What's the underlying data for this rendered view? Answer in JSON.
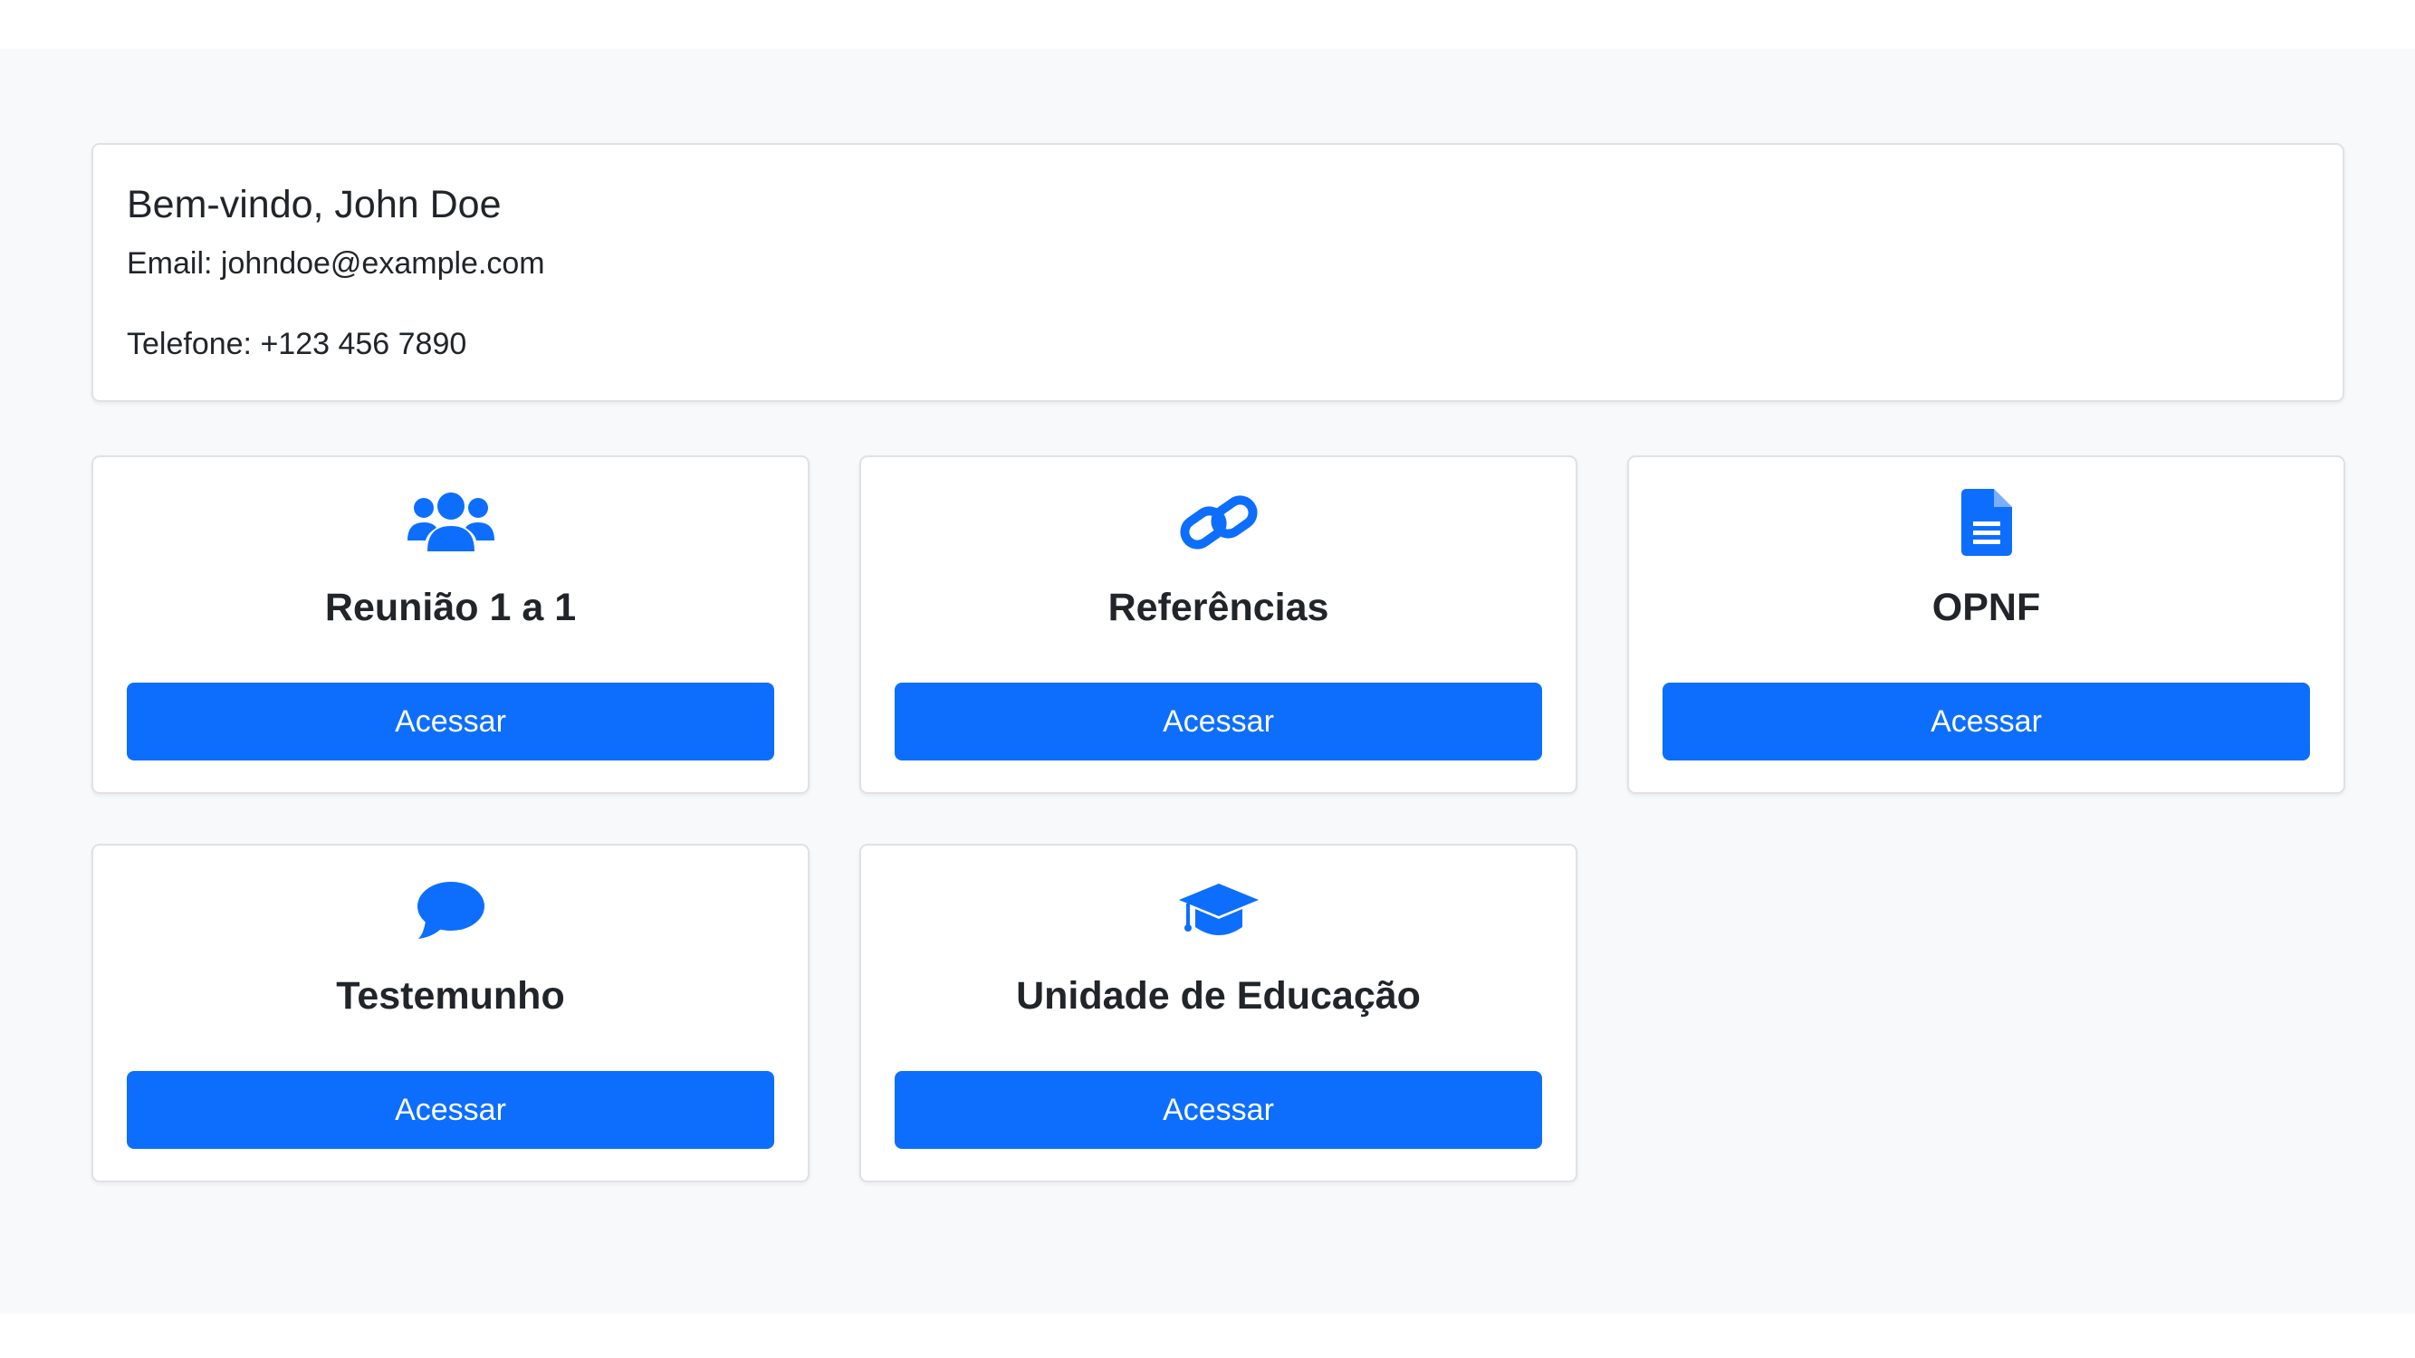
{
  "profile": {
    "welcome": "Bem-vindo, John Doe",
    "email_line": "Email: johndoe@example.com",
    "phone_line": "Telefone: +123 456 7890"
  },
  "theme": {
    "accent": "#0d6efd",
    "background": "#f8f9fa",
    "card_border": "#dee2e6"
  },
  "tiles": [
    {
      "title": "Reunião 1 a 1",
      "icon": "users-icon",
      "button": "Acessar"
    },
    {
      "title": "Referências",
      "icon": "link-icon",
      "button": "Acessar"
    },
    {
      "title": "OPNF",
      "icon": "document-icon",
      "button": "Acessar"
    },
    {
      "title": "Testemunho",
      "icon": "chat-bubble-icon",
      "button": "Acessar"
    },
    {
      "title": "Unidade de Educação",
      "icon": "graduation-cap-icon",
      "button": "Acessar"
    }
  ]
}
